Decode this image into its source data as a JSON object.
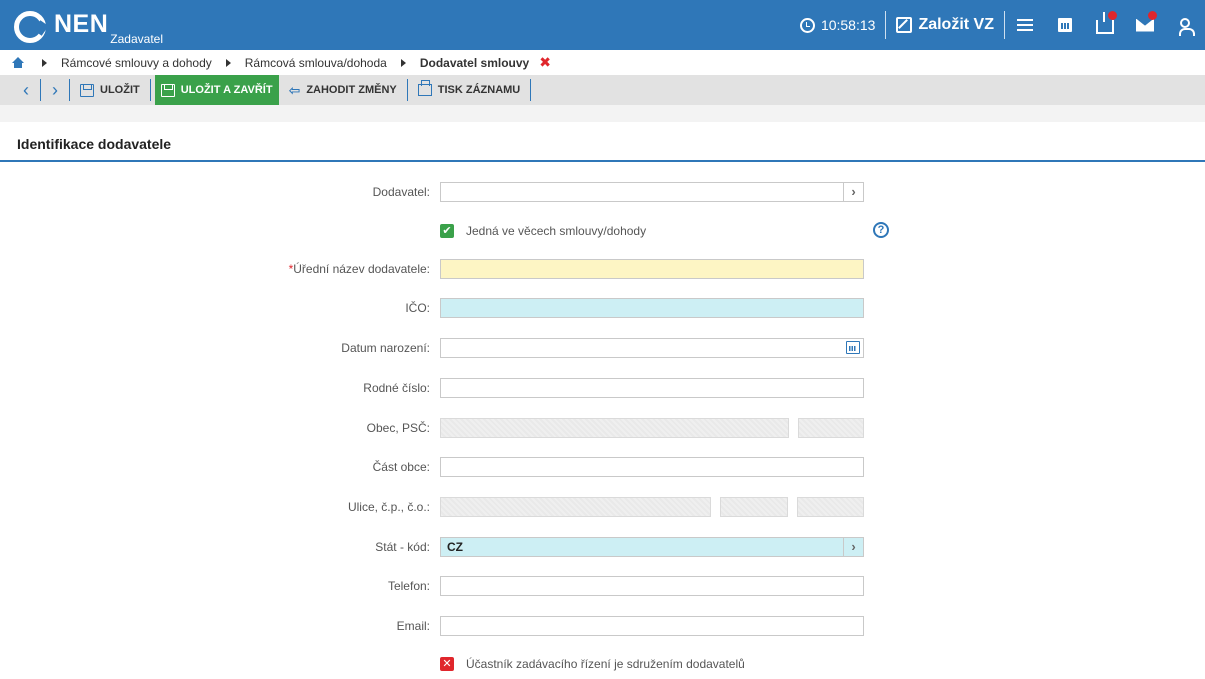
{
  "header": {
    "logo_name": "NEN",
    "logo_sub": "Zadavatel",
    "time": "10:58:13",
    "create_label": "Založit VZ",
    "icons": [
      "menu-icon",
      "calendar-icon",
      "inbox-icon",
      "mail-icon",
      "user-icon"
    ],
    "accent_color": "#2f77b8",
    "badge_color": "#e0262c"
  },
  "breadcrumb": {
    "items": [
      "Rámcové smlouvy a dohody",
      "Rámcová smlouva/dohoda"
    ],
    "current": "Dodavatel smlouvy",
    "close": "✖"
  },
  "toolbar": {
    "save": "ULOŽIT",
    "save_close": "ULOŽIT A ZAVŘÍT",
    "discard": "ZAHODIT ZMĚNY",
    "print": "TISK ZÁZNAMU",
    "green_color": "#3aa14a"
  },
  "section": {
    "title": "Identifikace dodavatele"
  },
  "form": {
    "dodavatel": {
      "label": "Dodavatel:",
      "value": ""
    },
    "jedna_checkbox": {
      "label": "Jedná ve věcech smlouvy/dohody",
      "checked": true
    },
    "help": "?",
    "uredni_nazev": {
      "required_mark": "*",
      "label": "Úřední název dodavatele:",
      "value": ""
    },
    "ico": {
      "label": "IČO:",
      "value": ""
    },
    "datum_narozeni": {
      "label": "Datum narození:",
      "value": ""
    },
    "rodne_cislo": {
      "label": "Rodné číslo:",
      "value": ""
    },
    "obec_psc": {
      "label": "Obec, PSČ:",
      "obec": "",
      "psc": ""
    },
    "cast_obce": {
      "label": "Část obce:",
      "value": ""
    },
    "ulice": {
      "label": "Ulice, č.p., č.o.:",
      "ulice": "",
      "cp": "",
      "co": ""
    },
    "stat_kod": {
      "label": "Stát - kód:",
      "value": "CZ"
    },
    "telefon": {
      "label": "Telefon:",
      "value": ""
    },
    "email": {
      "label": "Email:",
      "value": ""
    },
    "sdruzeni_checkbox": {
      "label": "Účastník zadávacího řízení je sdružením dodavatelů",
      "checked": false
    }
  }
}
